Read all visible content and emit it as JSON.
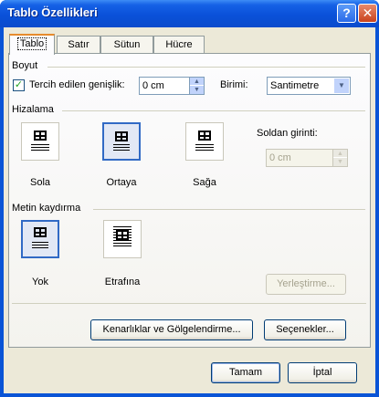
{
  "window": {
    "title": "Tablo Özellikleri",
    "help_glyph": "?",
    "close_glyph": "✕"
  },
  "tabs": [
    "Tablo",
    "Satır",
    "Sütun",
    "Hücre"
  ],
  "size_group": {
    "label": "Boyut",
    "preferred_width_label": "Tercih edilen genişlik:",
    "preferred_width_checked": true,
    "preferred_width_value": "0 cm",
    "unit_label": "Birimi:",
    "unit_value": "Santimetre"
  },
  "alignment_group": {
    "label": "Hizalama",
    "options": [
      "Sola",
      "Ortaya",
      "Sağa"
    ],
    "selected": "Ortaya",
    "indent_label": "Soldan girinti:",
    "indent_value": "0 cm"
  },
  "wrap_group": {
    "label": "Metin kaydırma",
    "options": [
      "Yok",
      "Etrafına"
    ],
    "selected": "Yok",
    "positioning_button": "Yerleştirme..."
  },
  "buttons": {
    "borders": "Kenarlıklar ve Gölgelendirme...",
    "options": "Seçenekler...",
    "ok": "Tamam",
    "cancel": "İptal"
  },
  "icons": {
    "check": "✓",
    "spin_up": "▲",
    "spin_down": "▼",
    "dropdown": "▼"
  }
}
